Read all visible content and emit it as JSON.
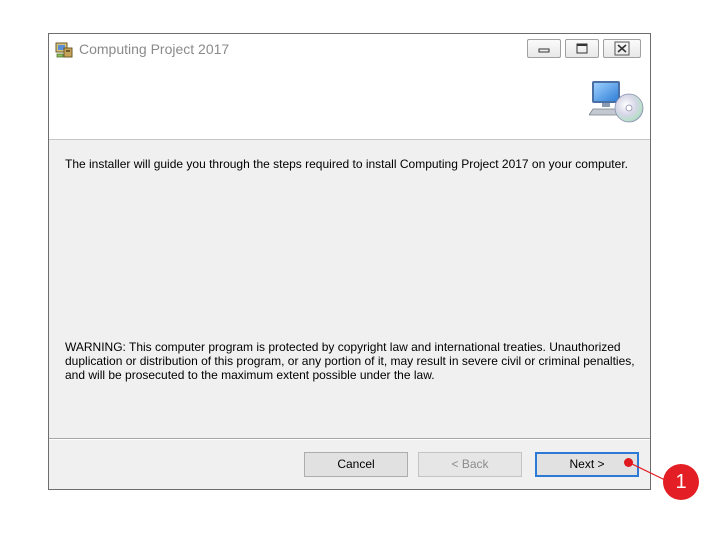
{
  "window": {
    "title": "Computing Project 2017",
    "controls": {
      "minimize_icon": "minimize-icon",
      "maximize_icon": "maximize-icon",
      "close_icon": "close-icon"
    }
  },
  "banner": {
    "icon": "computer-disc-icon"
  },
  "content": {
    "intro": "The installer will guide you through the steps required to install Computing Project 2017 on your computer.",
    "warning": "WARNING: This computer program is protected by copyright law and international treaties. Unauthorized duplication or distribution of this program, or any portion of it, may result in severe civil or criminal penalties, and will be prosecuted to the maximum extent possible under the law."
  },
  "buttons": {
    "cancel": "Cancel",
    "back": "< Back",
    "next": "Next >"
  },
  "annotation": {
    "step_number": "1",
    "color": "#e31e24"
  }
}
